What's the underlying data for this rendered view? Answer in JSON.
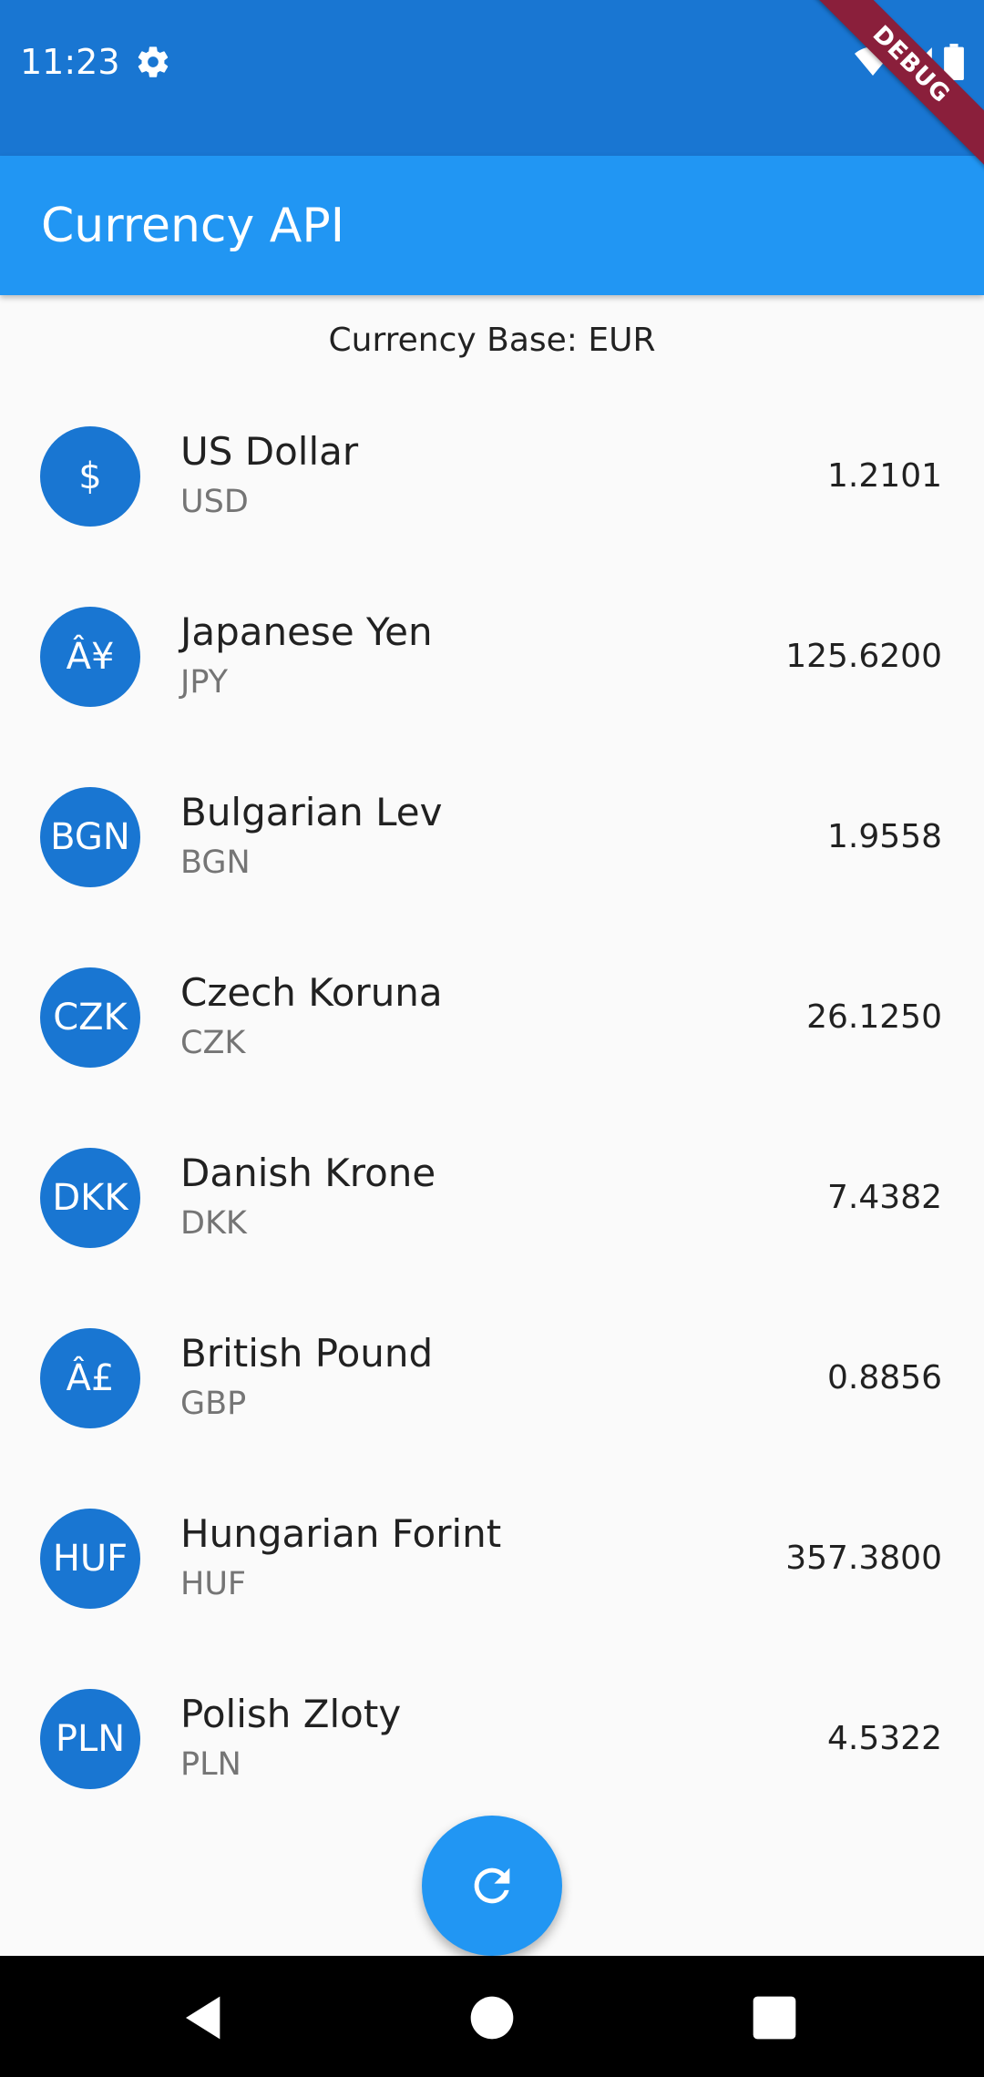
{
  "status_bar": {
    "time": "11:23",
    "icons": [
      "gear-icon",
      "wifi-icon",
      "signal-icon",
      "battery-icon"
    ],
    "color": "#1976d2"
  },
  "debug_banner": {
    "label": "DEBUG"
  },
  "app_bar": {
    "title": "Currency API",
    "color": "#2196f3"
  },
  "base_label": "Currency Base: EUR",
  "currencies": [
    {
      "symbol": "$",
      "name": "US Dollar",
      "code": "USD",
      "rate": "1.2101"
    },
    {
      "symbol": "Â¥",
      "name": "Japanese Yen",
      "code": "JPY",
      "rate": "125.6200"
    },
    {
      "symbol": "BGN",
      "name": "Bulgarian Lev",
      "code": "BGN",
      "rate": "1.9558"
    },
    {
      "symbol": "CZK",
      "name": "Czech Koruna",
      "code": "CZK",
      "rate": "26.1250"
    },
    {
      "symbol": "DKK",
      "name": "Danish Krone",
      "code": "DKK",
      "rate": "7.4382"
    },
    {
      "symbol": "Â£",
      "name": "British Pound",
      "code": "GBP",
      "rate": "0.8856"
    },
    {
      "symbol": "HUF",
      "name": "Hungarian Forint",
      "code": "HUF",
      "rate": "357.3800"
    },
    {
      "symbol": "PLN",
      "name": "Polish Zloty",
      "code": "PLN",
      "rate": "4.5322"
    }
  ],
  "fab": {
    "icon": "refresh-icon"
  },
  "nav_bar": {
    "icons": [
      "back-icon",
      "home-icon",
      "recents-icon"
    ]
  }
}
